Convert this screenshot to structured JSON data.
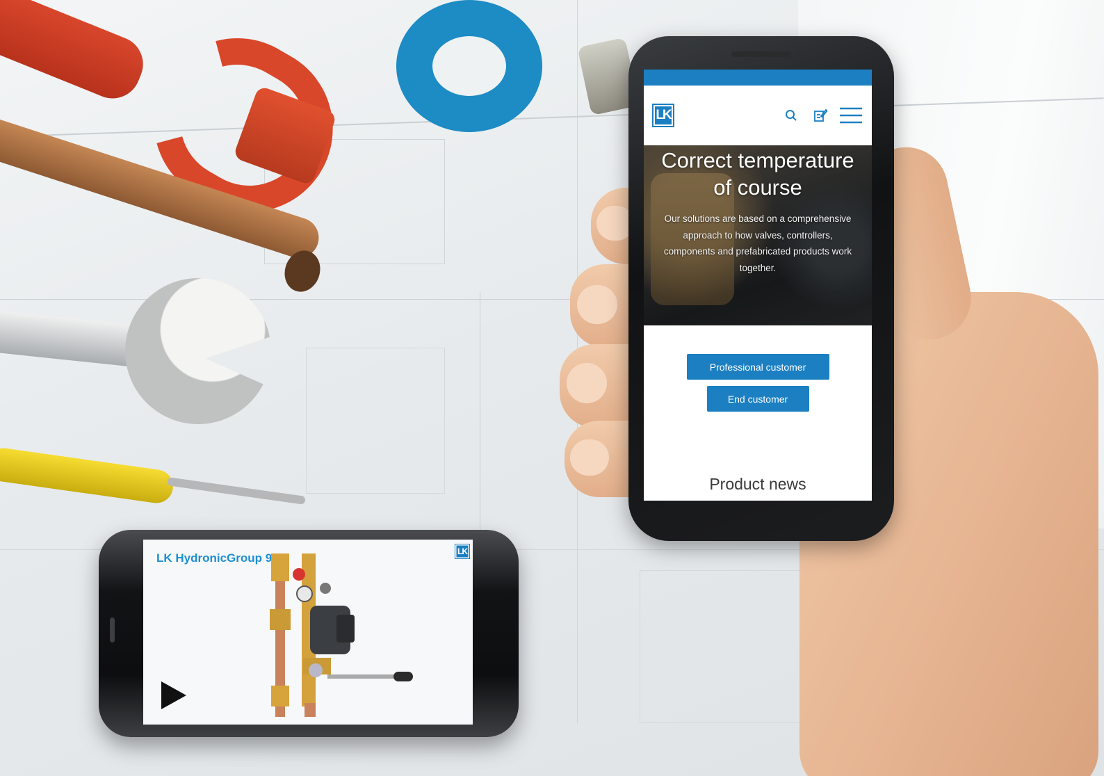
{
  "main_phone": {
    "header": {
      "logo_text": "LK",
      "icons": [
        "search-icon",
        "edit-icon",
        "menu-icon"
      ]
    },
    "hero": {
      "title": "Correct temperature of course",
      "text": "Our solutions are based on a comprehensive approach to how valves, controllers, components and prefabricated products work together."
    },
    "buttons": {
      "professional": "Professional customer",
      "end": "End customer"
    },
    "section_title": "Product news"
  },
  "video_phone": {
    "title": "LK HydronicGroup 90",
    "logo_text": "LK",
    "play_icon": "play-icon"
  },
  "colors": {
    "brand_blue": "#1b7fc2",
    "video_title_blue": "#1d8fcf"
  }
}
